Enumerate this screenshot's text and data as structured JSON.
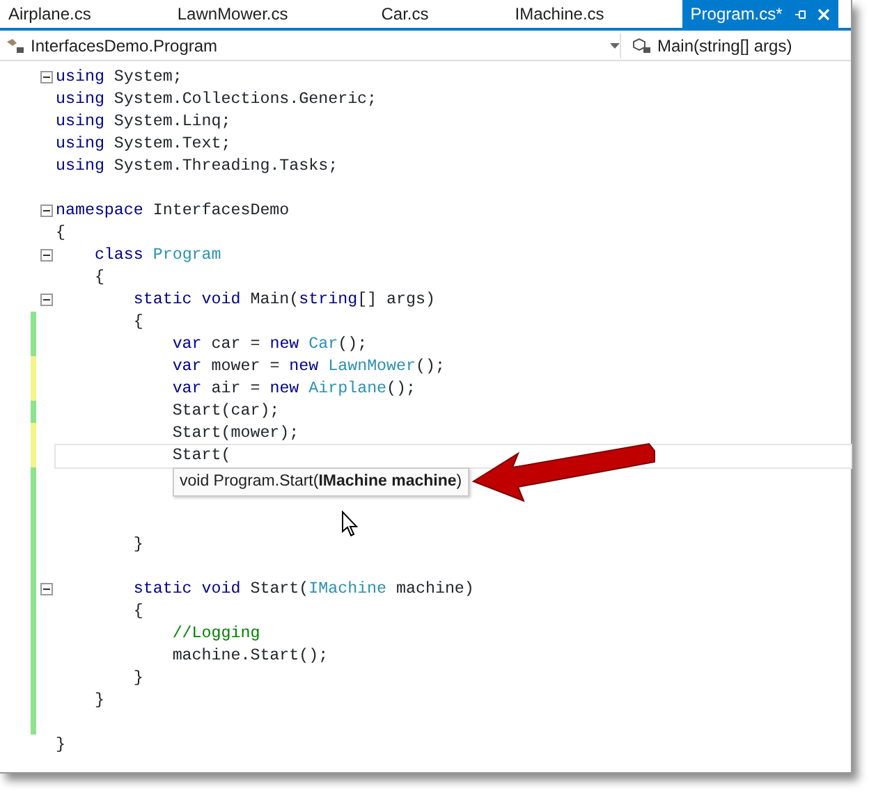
{
  "tabs": [
    {
      "label": "Airplane.cs",
      "selected": false
    },
    {
      "label": "LawnMower.cs",
      "selected": false
    },
    {
      "label": "Car.cs",
      "selected": false
    },
    {
      "label": "IMachine.cs",
      "selected": false
    },
    {
      "label": "Program.cs*",
      "selected": true
    }
  ],
  "nav_bar": {
    "type_dropdown": "InterfacesDemo.Program",
    "member_dropdown": "Main(string[] args)"
  },
  "code_lines": [
    {
      "kind": "code",
      "fold": true,
      "tokens": [
        {
          "text": "using ",
          "kind": "keyword"
        },
        {
          "text": "System;",
          "kind": "plain"
        }
      ]
    },
    {
      "kind": "code",
      "tokens": [
        {
          "text": "using ",
          "kind": "keyword"
        },
        {
          "text": "System.Collections.Generic;",
          "kind": "plain"
        }
      ]
    },
    {
      "kind": "code",
      "tokens": [
        {
          "text": "using ",
          "kind": "keyword"
        },
        {
          "text": "System.Linq;",
          "kind": "plain"
        }
      ]
    },
    {
      "kind": "code",
      "tokens": [
        {
          "text": "using ",
          "kind": "keyword"
        },
        {
          "text": "System.Text;",
          "kind": "plain"
        }
      ]
    },
    {
      "kind": "code",
      "tokens": [
        {
          "text": "using ",
          "kind": "keyword"
        },
        {
          "text": "System.Threading.Tasks;",
          "kind": "plain"
        }
      ]
    },
    {
      "kind": "blank"
    },
    {
      "kind": "code",
      "fold": true,
      "tokens": [
        {
          "text": "namespace ",
          "kind": "keyword"
        },
        {
          "text": "InterfacesDemo",
          "kind": "plain"
        }
      ]
    },
    {
      "kind": "code",
      "tokens": [
        {
          "text": "{",
          "kind": "plain"
        }
      ]
    },
    {
      "kind": "code",
      "fold": true,
      "tokens": [
        {
          "text": "    class ",
          "kind": "keyword"
        },
        {
          "text": "Program",
          "kind": "type"
        }
      ]
    },
    {
      "kind": "code",
      "tokens": [
        {
          "text": "    {",
          "kind": "plain"
        }
      ]
    },
    {
      "kind": "code",
      "fold": true,
      "tokens": [
        {
          "text": "        static void ",
          "kind": "keyword"
        },
        {
          "text": "Main(",
          "kind": "plain"
        },
        {
          "text": "string",
          "kind": "keyword"
        },
        {
          "text": "[] args)",
          "kind": "plain"
        }
      ]
    },
    {
      "kind": "code",
      "color": "#8ee28e",
      "tokens": [
        {
          "text": "        {",
          "kind": "plain"
        }
      ]
    },
    {
      "kind": "code",
      "color": "#8ee28e",
      "tokens": [
        {
          "text": "            var ",
          "kind": "keyword"
        },
        {
          "text": "car = ",
          "kind": "plain"
        },
        {
          "text": "new ",
          "kind": "keyword"
        },
        {
          "text": "Car",
          "kind": "type"
        },
        {
          "text": "();",
          "kind": "plain"
        }
      ]
    },
    {
      "kind": "code",
      "color": "#f4f48a",
      "tokens": [
        {
          "text": "            var ",
          "kind": "keyword"
        },
        {
          "text": "mower = ",
          "kind": "plain"
        },
        {
          "text": "new ",
          "kind": "keyword"
        },
        {
          "text": "LawnMower",
          "kind": "type"
        },
        {
          "text": "();",
          "kind": "plain"
        }
      ]
    },
    {
      "kind": "code",
      "color": "#f4f48a",
      "tokens": [
        {
          "text": "            var ",
          "kind": "keyword"
        },
        {
          "text": "air = ",
          "kind": "plain"
        },
        {
          "text": "new ",
          "kind": "keyword"
        },
        {
          "text": "Airplane",
          "kind": "type"
        },
        {
          "text": "();",
          "kind": "plain"
        }
      ]
    },
    {
      "kind": "code",
      "color": "#8ee28e",
      "tokens": [
        {
          "text": "            Start(car);",
          "kind": "plain"
        }
      ]
    },
    {
      "kind": "code",
      "color": "#f4f48a",
      "tokens": [
        {
          "text": "            Start(mower);",
          "kind": "plain"
        }
      ]
    },
    {
      "kind": "code",
      "color": "#f4f48a",
      "current": true,
      "tokens": [
        {
          "text": "            Start(",
          "kind": "plain"
        }
      ]
    },
    {
      "kind": "blank",
      "color": "#8ee28e"
    },
    {
      "kind": "blank",
      "color": "#8ee28e"
    },
    {
      "kind": "blank",
      "color": "#8ee28e"
    },
    {
      "kind": "code",
      "color": "#8ee28e",
      "tokens": [
        {
          "text": "        }",
          "kind": "plain"
        }
      ]
    },
    {
      "kind": "blank",
      "color": "#8ee28e"
    },
    {
      "kind": "code",
      "color": "#8ee28e",
      "fold": true,
      "tokens": [
        {
          "text": "        static void ",
          "kind": "keyword"
        },
        {
          "text": "Start(",
          "kind": "plain"
        },
        {
          "text": "IMachine",
          "kind": "type"
        },
        {
          "text": " machine)",
          "kind": "plain"
        }
      ]
    },
    {
      "kind": "code",
      "color": "#8ee28e",
      "tokens": [
        {
          "text": "        {",
          "kind": "plain"
        }
      ]
    },
    {
      "kind": "code",
      "color": "#8ee28e",
      "tokens": [
        {
          "text": "            //Logging",
          "kind": "comment"
        }
      ]
    },
    {
      "kind": "code",
      "color": "#8ee28e",
      "tokens": [
        {
          "text": "            machine.Start();",
          "kind": "plain"
        }
      ]
    },
    {
      "kind": "code",
      "color": "#8ee28e",
      "tokens": [
        {
          "text": "        }",
          "kind": "plain"
        }
      ]
    },
    {
      "kind": "code",
      "color": "#8ee28e",
      "tokens": [
        {
          "text": "    }",
          "kind": "plain"
        }
      ]
    },
    {
      "kind": "blank",
      "color": "#8ee28e"
    },
    {
      "kind": "code",
      "tokens": [
        {
          "text": "}",
          "kind": "plain"
        }
      ]
    }
  ],
  "tooltip": {
    "text": "void Program.Start(**IMachine machine**)"
  }
}
